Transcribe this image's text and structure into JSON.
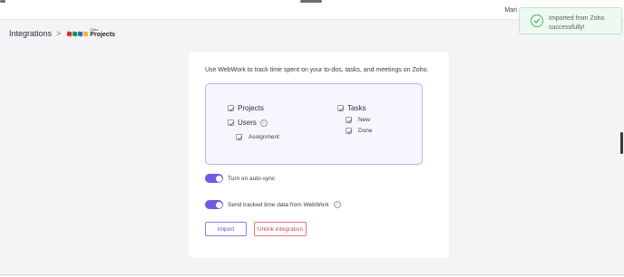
{
  "topbar": {
    "user_name": "Mari"
  },
  "breadcrumb": {
    "parent": "Integrations",
    "separator": ">",
    "logo_small": "Zoho",
    "logo_big": "Projects"
  },
  "toast": {
    "message": "Imported from Zoho successfully!",
    "status_color": "#4caf6d"
  },
  "card": {
    "intro": "Use WebWork to track time spent on your to-dos, tasks, and meetings on Zoho.",
    "options": {
      "projects": "Projects",
      "users": "Users",
      "assignment": "Assignment",
      "tasks": "Tasks",
      "new": "New",
      "done": "Done"
    },
    "toggles": [
      {
        "label": "Turn on auto-sync",
        "on": true
      },
      {
        "label": "Send tracked time data from WebWork",
        "on": true
      }
    ],
    "buttons": {
      "import": "Import",
      "unlink": "Unlink integration"
    }
  },
  "colors": {
    "accent": "#6b5be6",
    "danger": "#d9474c",
    "success": "#4caf6d"
  }
}
